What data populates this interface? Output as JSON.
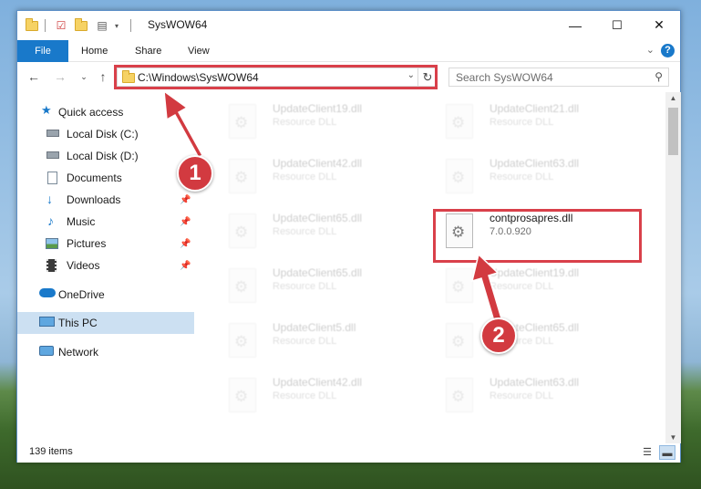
{
  "window": {
    "title": "SysWOW64",
    "controls": {
      "minimize": "—",
      "maximize": "☐",
      "close": "✕"
    }
  },
  "ribbon": {
    "tabs": [
      "File",
      "Home",
      "Share",
      "View"
    ],
    "help": "?"
  },
  "nav": {
    "address": "C:\\Windows\\SysWOW64",
    "search_placeholder": "Search SysWOW64"
  },
  "sidebar": {
    "items": [
      {
        "label": "Quick access",
        "icon": "star-icon"
      },
      {
        "label": "Local Disk (C:)",
        "icon": "drive-icon"
      },
      {
        "label": "Local Disk (D:)",
        "icon": "drive-icon"
      },
      {
        "label": "Documents",
        "icon": "documents-icon"
      },
      {
        "label": "Downloads",
        "icon": "download-icon"
      },
      {
        "label": "Music",
        "icon": "music-icon"
      },
      {
        "label": "Pictures",
        "icon": "pictures-icon"
      },
      {
        "label": "Videos",
        "icon": "videos-icon"
      },
      {
        "label": "OneDrive",
        "icon": "cloud-icon"
      },
      {
        "label": "This PC",
        "icon": "computer-icon"
      },
      {
        "label": "Network",
        "icon": "network-icon"
      }
    ]
  },
  "files": [
    {
      "name": "UpdateClient19.dll",
      "sub": "Resource DLL"
    },
    {
      "name": "UpdateClient21.dll",
      "sub": "Resource DLL"
    },
    {
      "name": "UpdateClient42.dll",
      "sub": "Resource DLL"
    },
    {
      "name": "UpdateClient63.dll",
      "sub": "Resource DLL"
    },
    {
      "name": "UpdateClient65.dll",
      "sub": "Resource DLL"
    },
    {
      "name": "contprosapres.dll",
      "sub": "7.0.0.920"
    },
    {
      "name": "UpdateClient65.dll",
      "sub": "Resource DLL"
    },
    {
      "name": "UpdateClient19.dll",
      "sub": "Resource DLL"
    },
    {
      "name": "UpdateClient5.dll",
      "sub": "Resource DLL"
    },
    {
      "name": "UpdateClient65.dll",
      "sub": "Resource DLL"
    },
    {
      "name": "UpdateClient42.dll",
      "sub": "Resource DLL"
    },
    {
      "name": "UpdateClient63.dll",
      "sub": "Resource DLL"
    }
  ],
  "status": {
    "item_count": "139 items"
  },
  "callouts": [
    "1",
    "2"
  ],
  "colors": {
    "accent": "#1979ca",
    "highlight": "#d9404a",
    "selected": "#cce0f2"
  }
}
